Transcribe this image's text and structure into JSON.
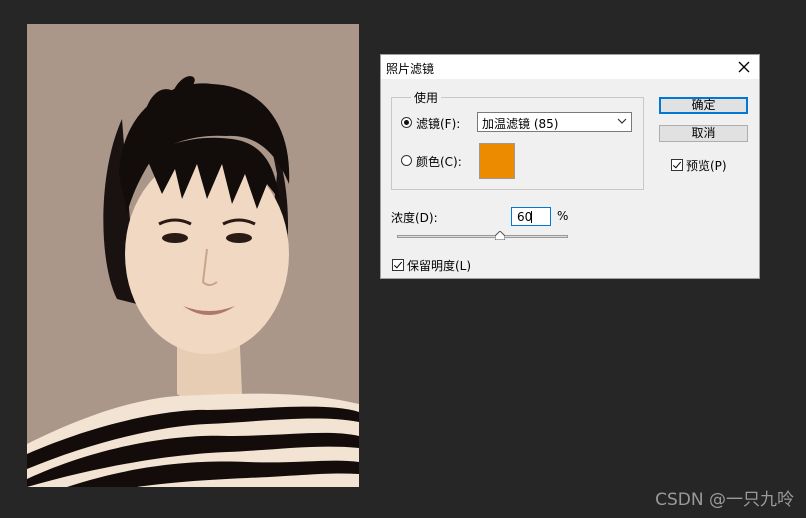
{
  "dialog": {
    "title": "照片滤镜",
    "use_group_label": "使用",
    "filter_label": "滤镜(F):",
    "filter_value": "加温滤镜 (85)",
    "color_label": "颜色(C):",
    "color_swatch": "#ec8b00",
    "density_label": "浓度(D):",
    "density_value": "60",
    "density_unit": "%",
    "density_slider_fraction": 0.6,
    "preserve_label": "保留明度(L)",
    "preserve_checked": true,
    "ok_label": "确定",
    "cancel_label": "取消",
    "preview_label": "预览(P)",
    "preview_checked": true,
    "selected_mode": "filter"
  },
  "colors": {
    "workspace_bg": "#262626",
    "photo_bg": "#ab968a",
    "accent": "#0078d7"
  },
  "watermark": "CSDN @一只九呤"
}
